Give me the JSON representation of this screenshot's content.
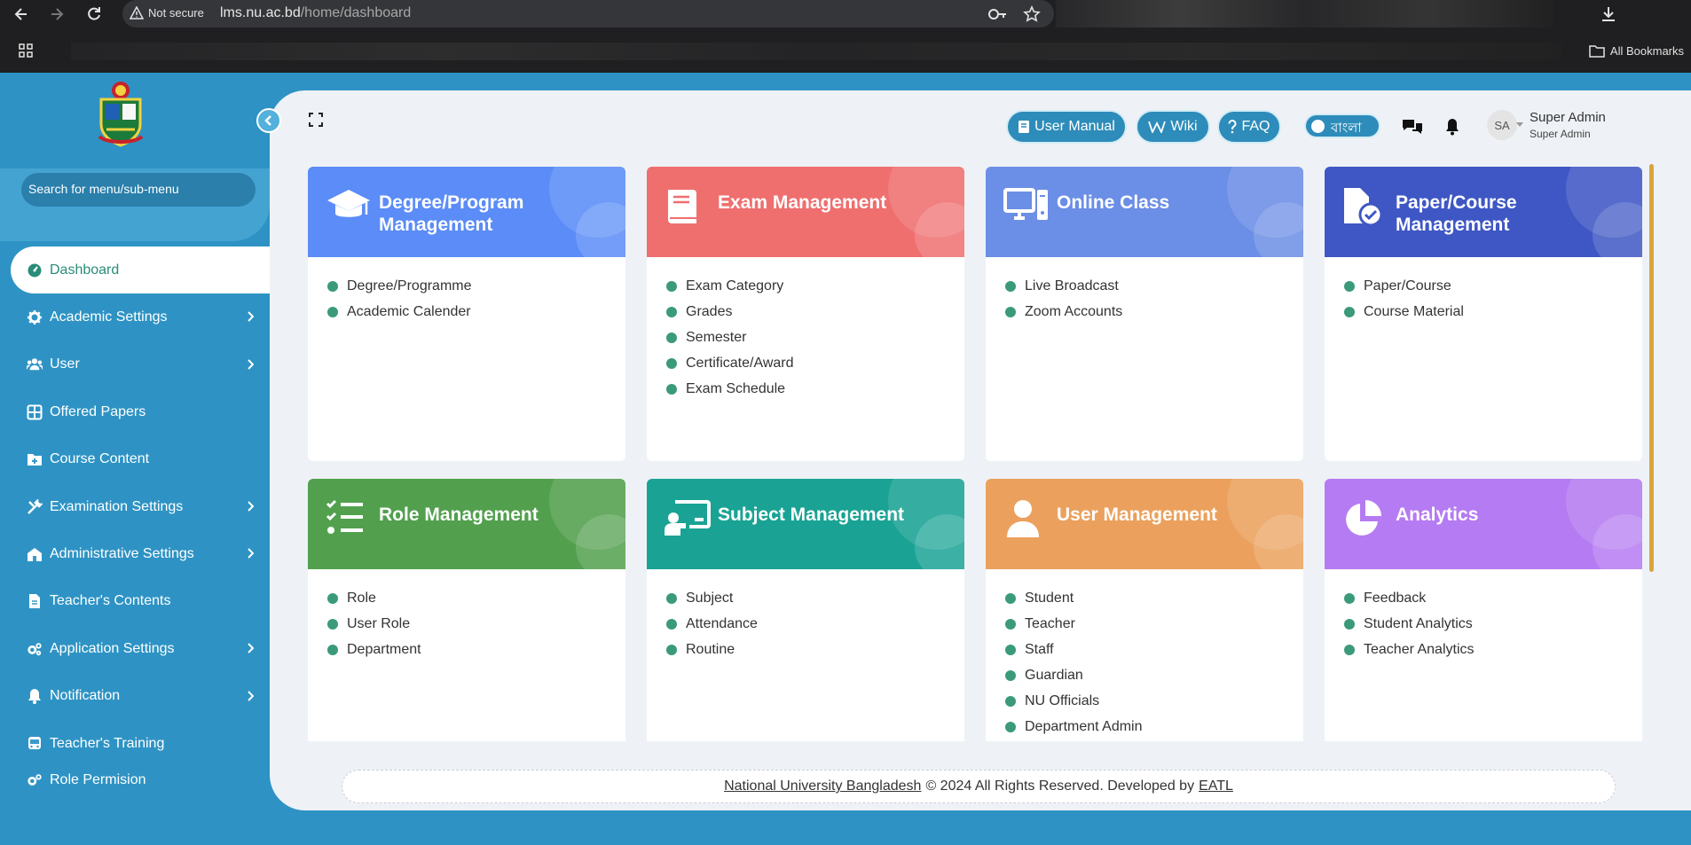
{
  "browser": {
    "security_label": "Not secure",
    "url_host": "lms.nu.ac.bd",
    "url_path": "/home/dashboard",
    "all_bookmarks": "All Bookmarks"
  },
  "sidebar": {
    "search_placeholder": "Search for menu/sub-menu",
    "items": [
      {
        "label": "Dashboard",
        "icon": "dashboard-icon"
      },
      {
        "label": "Academic Settings",
        "icon": "gear-icon"
      },
      {
        "label": "User",
        "icon": "users-icon"
      },
      {
        "label": "Offered Papers",
        "icon": "grid-icon"
      },
      {
        "label": "Course Content",
        "icon": "folder-plus-icon"
      },
      {
        "label": "Examination Settings",
        "icon": "tools-icon"
      },
      {
        "label": "Administrative Settings",
        "icon": "building-icon"
      },
      {
        "label": "Teacher's Contents",
        "icon": "file-icon"
      },
      {
        "label": "Application Settings",
        "icon": "gears-icon"
      },
      {
        "label": "Notification",
        "icon": "bell-icon"
      },
      {
        "label": "Teacher's Training",
        "icon": "bus-icon"
      },
      {
        "label": "Role Permision",
        "icon": "gears-icon"
      }
    ]
  },
  "header": {
    "user_manual": "User Manual",
    "wiki": "Wiki",
    "faq": "FAQ",
    "language_toggle": "বাংলা",
    "avatar_initials": "SA",
    "user_name": "Super Admin",
    "user_role": "Super Admin"
  },
  "cards": [
    {
      "title": "Degree/Program Management",
      "color": "#5b8cf7",
      "icon": "graduation-cap-icon",
      "items": [
        "Degree/Programme",
        "Academic Calender"
      ]
    },
    {
      "title": "Exam Management",
      "color": "#ef6f6f",
      "icon": "book-icon",
      "items": [
        "Exam Category",
        "Grades",
        "Semester",
        "Certificate/Award",
        "Exam Schedule"
      ]
    },
    {
      "title": "Online Class",
      "color": "#6b8ee6",
      "icon": "desktop-icon",
      "items": [
        "Live Broadcast",
        "Zoom Accounts"
      ]
    },
    {
      "title": "Paper/Course Management",
      "color": "#3f57c4",
      "icon": "file-check-icon",
      "items": [
        "Paper/Course",
        "Course Material"
      ]
    },
    {
      "title": "Role Management",
      "color": "#52a04e",
      "icon": "list-check-icon",
      "items": [
        "Role",
        "User Role",
        "Department"
      ]
    },
    {
      "title": "Subject Management",
      "color": "#1aa394",
      "icon": "teacher-board-icon",
      "items": [
        "Subject",
        "Attendance",
        "Routine"
      ]
    },
    {
      "title": "User Management",
      "color": "#eba15d",
      "icon": "user-icon",
      "items": [
        "Student",
        "Teacher",
        "Staff",
        "Guardian",
        "NU Officials",
        "Department Admin"
      ]
    },
    {
      "title": "Analytics",
      "color": "#b57bf2",
      "icon": "pie-chart-icon",
      "items": [
        "Feedback",
        "Student Analytics",
        "Teacher Analytics"
      ]
    }
  ],
  "footer": {
    "org": "National University Bangladesh",
    "text": "© 2024 All Rights Reserved. Developed by",
    "dev": "EATL"
  }
}
